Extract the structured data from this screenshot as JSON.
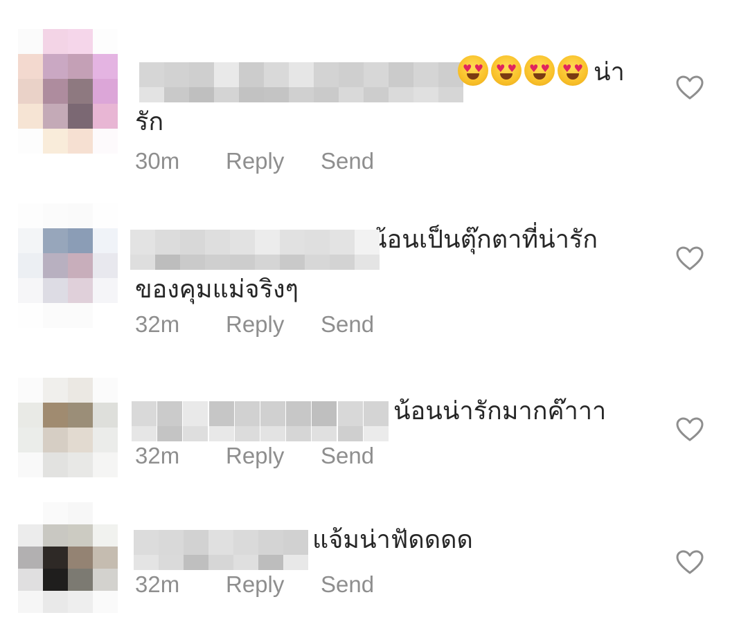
{
  "colors": {
    "text": "#262626",
    "meta": "#8e8e8e",
    "heart_outline": "#8e8e8e"
  },
  "comments": [
    {
      "username": "",
      "emojis": [
        "smiling-face-with-heart-eyes",
        "smiling-face-with-heart-eyes",
        "smiling-face-with-heart-eyes",
        "smiling-face-with-heart-eyes"
      ],
      "text": "น่ารัก",
      "time": "30m",
      "reply_label": "Reply",
      "send_label": "Send",
      "like_icon": "heart-outline-icon"
    },
    {
      "username": "",
      "text": "น้อนเป็นตุ๊กตาที่น่ารักของคุมแม่จริงๆ",
      "time": "32m",
      "reply_label": "Reply",
      "send_label": "Send",
      "like_icon": "heart-outline-icon"
    },
    {
      "username": "",
      "text": "น้อนน่ารักมากค๊าาา",
      "time": "32m",
      "reply_label": "Reply",
      "send_label": "Send",
      "like_icon": "heart-outline-icon"
    },
    {
      "username": "",
      "text": "แจ้มน่าฟัดดดด",
      "time": "32m",
      "reply_label": "Reply",
      "send_label": "Send",
      "like_icon": "heart-outline-icon"
    }
  ]
}
